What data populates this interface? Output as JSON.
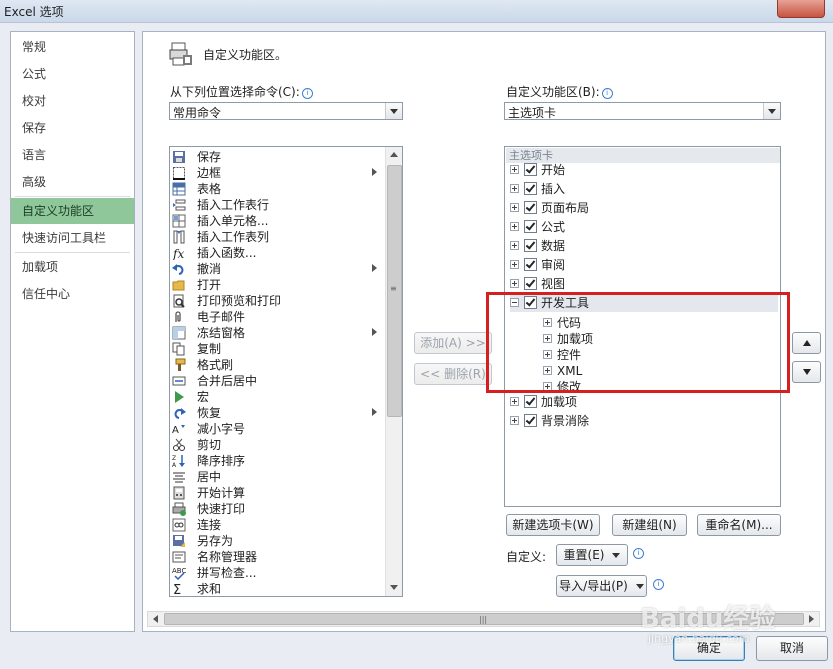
{
  "window": {
    "title": "Excel 选项"
  },
  "nav": {
    "items": [
      {
        "label": "常规"
      },
      {
        "label": "公式"
      },
      {
        "label": "校对"
      },
      {
        "label": "保存"
      },
      {
        "label": "语言"
      },
      {
        "label": "高级"
      },
      {
        "label": "自定义功能区"
      },
      {
        "label": "快速访问工具栏"
      },
      {
        "label": "加载项"
      },
      {
        "label": "信任中心"
      }
    ],
    "active": "自定义功能区"
  },
  "header": {
    "title": "自定义功能区。"
  },
  "left": {
    "label": "从下列位置选择命令(C):",
    "combo_value": "常用命令",
    "commands": [
      {
        "label": "保存",
        "icon": "save-icon"
      },
      {
        "label": "边框",
        "icon": "border-icon",
        "submenu": true
      },
      {
        "label": "表格",
        "icon": "table-icon"
      },
      {
        "label": "插入工作表行",
        "icon": "insert-row-icon"
      },
      {
        "label": "插入单元格...",
        "icon": "insert-cell-icon"
      },
      {
        "label": "插入工作表列",
        "icon": "insert-column-icon"
      },
      {
        "label": "插入函数...",
        "icon": "function-icon"
      },
      {
        "label": "撤消",
        "icon": "undo-icon",
        "submenu": true
      },
      {
        "label": "打开",
        "icon": "folder-icon"
      },
      {
        "label": "打印预览和打印",
        "icon": "print-preview-icon"
      },
      {
        "label": "电子邮件",
        "icon": "mail-attach-icon"
      },
      {
        "label": "冻结窗格",
        "icon": "freeze-panes-icon",
        "submenu": true
      },
      {
        "label": "复制",
        "icon": "copy-icon"
      },
      {
        "label": "格式刷",
        "icon": "format-painter-icon"
      },
      {
        "label": "合并后居中",
        "icon": "merge-center-icon"
      },
      {
        "label": "宏",
        "icon": "macro-play-icon"
      },
      {
        "label": "恢复",
        "icon": "redo-icon",
        "submenu": true
      },
      {
        "label": "减小字号",
        "icon": "decrease-font-icon"
      },
      {
        "label": "剪切",
        "icon": "cut-icon"
      },
      {
        "label": "降序排序",
        "icon": "sort-desc-icon"
      },
      {
        "label": "居中",
        "icon": "align-center-icon"
      },
      {
        "label": "开始计算",
        "icon": "calculator-icon"
      },
      {
        "label": "快速打印",
        "icon": "quick-print-icon"
      },
      {
        "label": "连接",
        "icon": "connection-icon"
      },
      {
        "label": "另存为",
        "icon": "save-as-icon"
      },
      {
        "label": "名称管理器",
        "icon": "name-manager-icon"
      },
      {
        "label": "拼写检查...",
        "icon": "spell-check-icon"
      },
      {
        "label": "求和",
        "icon": "sum-icon"
      }
    ]
  },
  "middle": {
    "add_label": "添加(A) >>",
    "remove_label": "<< 删除(R)"
  },
  "right": {
    "label": "自定义功能区(B):",
    "combo_value": "主选项卡",
    "tree_header": "主选项卡",
    "tabs": [
      {
        "label": "开始"
      },
      {
        "label": "插入"
      },
      {
        "label": "页面布局"
      },
      {
        "label": "公式"
      },
      {
        "label": "数据"
      },
      {
        "label": "审阅"
      },
      {
        "label": "视图"
      }
    ],
    "dev_tab": {
      "label": "开发工具",
      "children": [
        {
          "label": "代码"
        },
        {
          "label": "加载项"
        },
        {
          "label": "控件"
        },
        {
          "label": "XML"
        },
        {
          "label": "修改"
        }
      ]
    },
    "tabs_after": [
      {
        "label": "加载项"
      },
      {
        "label": "背景消除"
      }
    ],
    "new_tab_label": "新建选项卡(W)",
    "new_group_label": "新建组(N)",
    "rename_label": "重命名(M)...",
    "customize_label": "自定义:",
    "reset_label": "重置(E)",
    "import_export_label": "导入/导出(P)"
  },
  "footer": {
    "ok_label": "确定",
    "cancel_label": "取消"
  },
  "watermark": {
    "main": "Baidu经验",
    "sub": "jingyan.baidu.com"
  },
  "colors": {
    "nav_active": "#8fc79b",
    "highlight": "#d42020",
    "accent": "#3d7fd0"
  }
}
